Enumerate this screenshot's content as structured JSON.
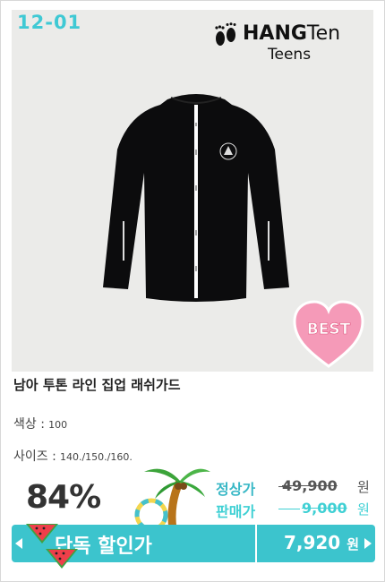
{
  "product": {
    "code": "12-01",
    "brand": {
      "name_bold": "HANG",
      "name_light": "Ten",
      "sub": "Teens"
    },
    "badge": "BEST",
    "title": "남아 투톤 라인 집업 래쉬가드",
    "color_label": "색상 :",
    "color_value": "100",
    "size_label": "사이즈 :",
    "size_value": "140./150./160.",
    "discount": "84%",
    "regular_label": "정상가",
    "regular_price": "49,900",
    "sale_label": "판매가",
    "sale_price": "9,000",
    "currency": "원",
    "exclusive_label": "단독 할인가",
    "final_price": "7,920",
    "colors": {
      "accent": "#3cc4cd",
      "badge_pink": "#f59ab8",
      "code": "#3fc9d4"
    }
  },
  "icons": [
    "footprints-icon",
    "heart-badge-icon",
    "palm-tree-icon",
    "watermelon-icon",
    "arrow-left-icon",
    "arrow-right-icon"
  ]
}
